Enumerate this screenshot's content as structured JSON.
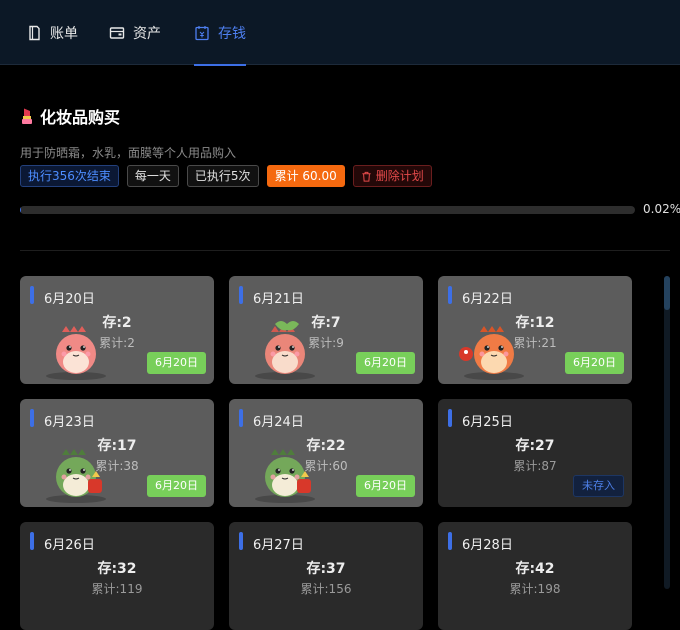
{
  "tabs": [
    {
      "label": "账单",
      "icon": "bill-icon",
      "active": false
    },
    {
      "label": "资产",
      "icon": "wallet-icon",
      "active": false
    },
    {
      "label": "存钱",
      "icon": "savings-calendar-icon",
      "active": true
    }
  ],
  "plan": {
    "emoji": "💄",
    "title": "化妆品购买",
    "description": "用于防晒霜，水乳，面膜等个人用品购入",
    "tags": {
      "status": "执行356次结束",
      "frequency": "每一天",
      "executed": "已执行5次",
      "total": "累计 60.00",
      "delete": "删除计划"
    },
    "progress": {
      "value": 0.0002,
      "label": "0.02%"
    }
  },
  "records": [
    {
      "date": "6月20日",
      "amount": "存:2",
      "total": "累计:2",
      "status": "6月20日",
      "saved": true,
      "mascot": "pink"
    },
    {
      "date": "6月21日",
      "amount": "存:7",
      "total": "累计:9",
      "status": "6月20日",
      "saved": true,
      "mascot": "pink-plant"
    },
    {
      "date": "6月22日",
      "amount": "存:12",
      "total": "累计:21",
      "status": "6月20日",
      "saved": true,
      "mascot": "orange"
    },
    {
      "date": "6月23日",
      "amount": "存:17",
      "total": "累计:38",
      "status": "6月20日",
      "saved": true,
      "mascot": "green"
    },
    {
      "date": "6月24日",
      "amount": "存:22",
      "total": "累计:60",
      "status": "6月20日",
      "saved": true,
      "mascot": "green"
    },
    {
      "date": "6月25日",
      "amount": "存:27",
      "total": "累计:87",
      "status": "未存入",
      "saved": false
    },
    {
      "date": "6月26日",
      "amount": "存:32",
      "total": "累计:119",
      "status": "",
      "saved": false
    },
    {
      "date": "6月27日",
      "amount": "存:37",
      "total": "累计:156",
      "status": "",
      "saved": false
    },
    {
      "date": "6月28日",
      "amount": "存:42",
      "total": "累计:198",
      "status": "",
      "saved": false
    }
  ],
  "colors": {
    "accent": "#3d6fe6",
    "saved_badge": "#78cf5a",
    "total_tag": "#f5690f",
    "danger": "#e34a4a"
  }
}
